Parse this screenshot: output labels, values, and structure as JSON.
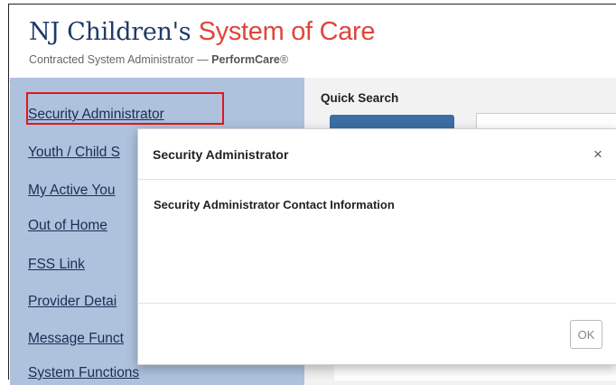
{
  "header": {
    "brand_part1": "NJ Children's ",
    "brand_part2": "System of Care",
    "subtitle_prefix": "Contracted System Administrator — ",
    "subtitle_strong": "PerformCare",
    "subtitle_mark": "®"
  },
  "sidebar": {
    "items": [
      {
        "label": "Security Administrator"
      },
      {
        "label": "Youth / Child S"
      },
      {
        "label": "My Active You"
      },
      {
        "label": "Out of Home"
      },
      {
        "label": "FSS Link"
      },
      {
        "label": "Provider Detai"
      },
      {
        "label": "Message Funct"
      },
      {
        "label": "System Functions"
      }
    ]
  },
  "quick_search": {
    "label": "Quick Search"
  },
  "modal": {
    "title": "Security Administrator",
    "close_glyph": "×",
    "body_heading": "Security Administrator Contact Information",
    "ok_label": "OK"
  },
  "colors": {
    "brand_dark": "#1f3a68",
    "brand_red": "#e0453a",
    "sidebar_bg": "#afc2dd",
    "highlight": "#e5141c",
    "quick_search_button": "#3a6ea5"
  }
}
